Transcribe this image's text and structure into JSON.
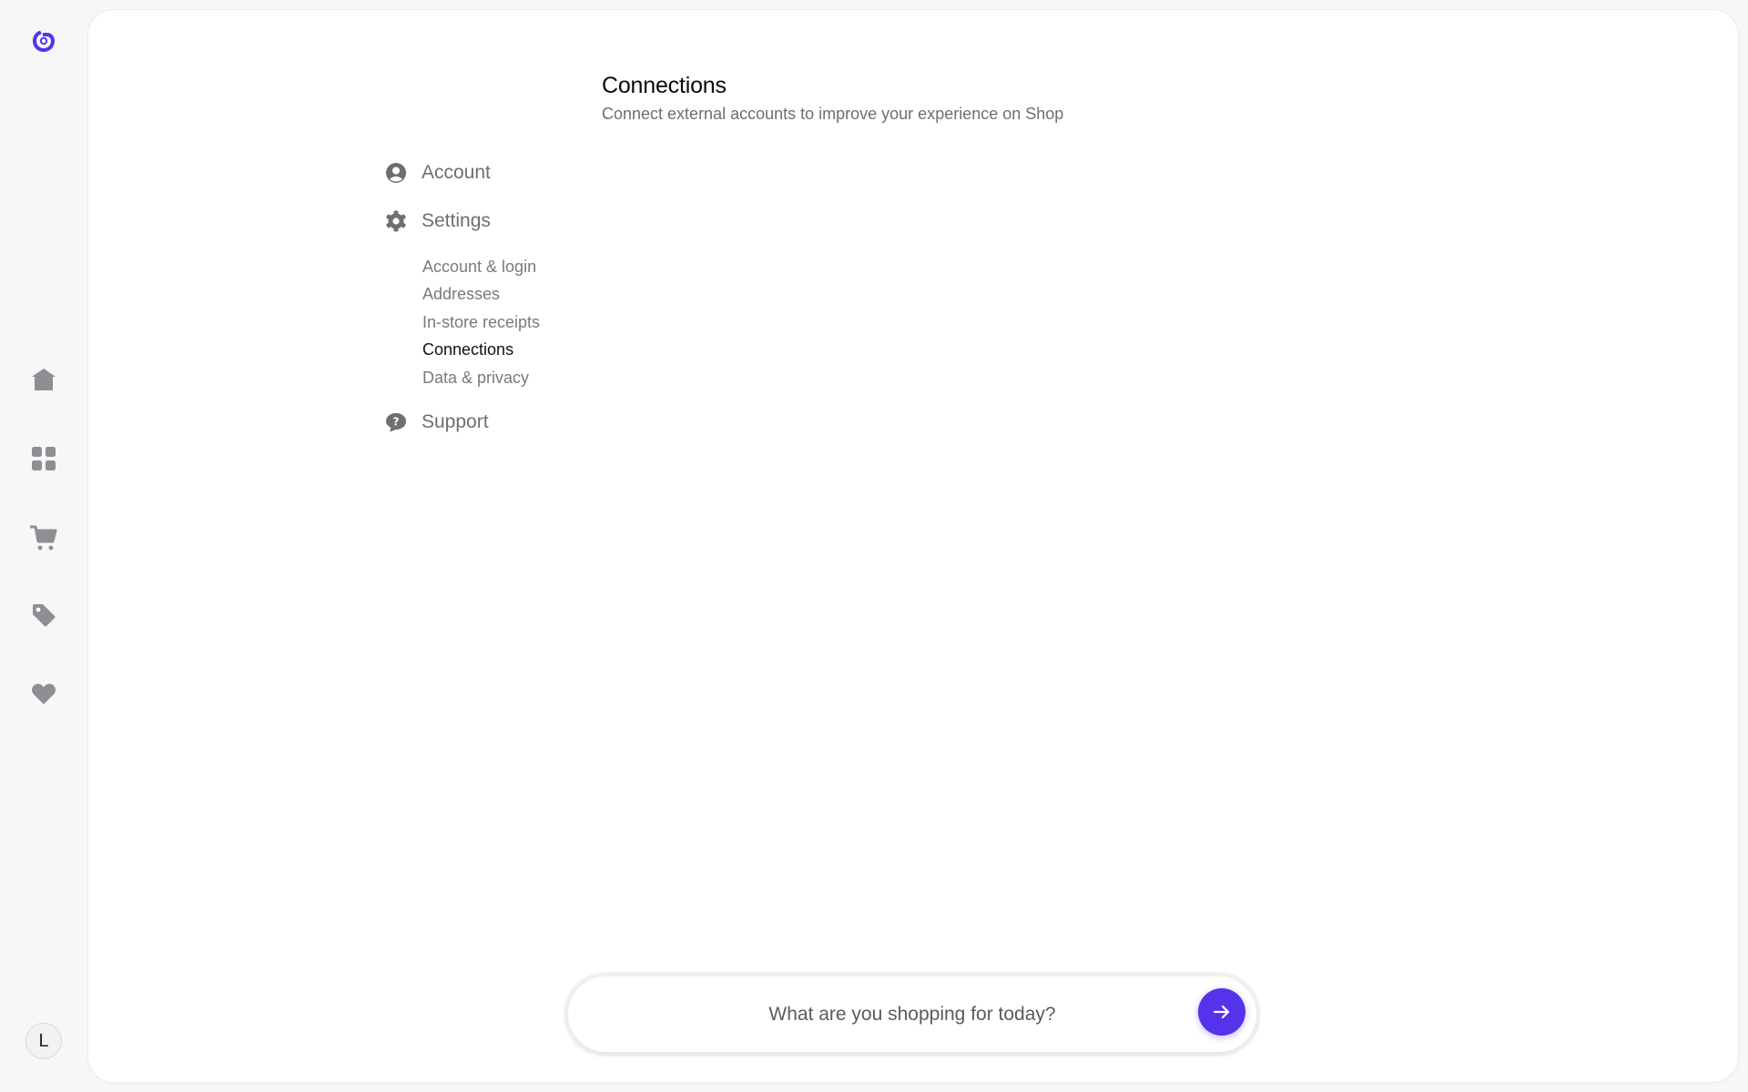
{
  "colors": {
    "accent": "#5433EB",
    "icon_gray": "#8e8e93",
    "text_muted": "#6e6e73",
    "text_active": "#111111"
  },
  "rail": {
    "logo_icon": "shop-logo-icon",
    "items": [
      {
        "name": "home",
        "icon": "home-icon"
      },
      {
        "name": "categories",
        "icon": "grid-icon"
      },
      {
        "name": "cart",
        "icon": "cart-icon"
      },
      {
        "name": "deals",
        "icon": "tag-icon"
      },
      {
        "name": "favorites",
        "icon": "heart-icon"
      }
    ],
    "avatar_initial": "L"
  },
  "settings_nav": {
    "top_items": [
      {
        "label": "Account",
        "icon": "person-icon"
      },
      {
        "label": "Settings",
        "icon": "gear-icon"
      },
      {
        "label": "Support",
        "icon": "help-chat-icon"
      }
    ],
    "sub_items": [
      {
        "label": "Account & login",
        "active": false
      },
      {
        "label": "Addresses",
        "active": false
      },
      {
        "label": "In-store receipts",
        "active": false
      },
      {
        "label": "Connections",
        "active": true
      },
      {
        "label": "Data & privacy",
        "active": false
      }
    ]
  },
  "main": {
    "title": "Connections",
    "subtitle": "Connect external accounts to improve your experience on Shop"
  },
  "search": {
    "placeholder": "What are you shopping for today?",
    "value": "",
    "submit_icon": "arrow-right-icon"
  }
}
